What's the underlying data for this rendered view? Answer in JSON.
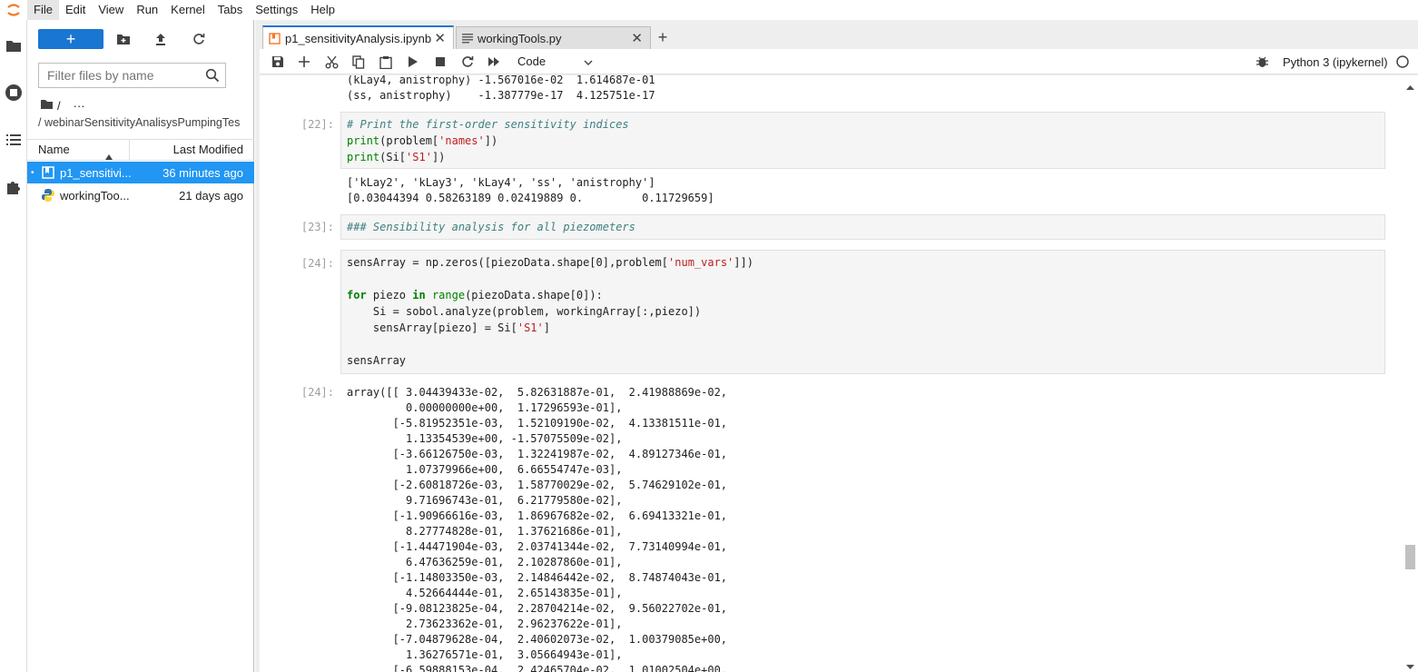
{
  "menu": [
    "File",
    "Edit",
    "View",
    "Run",
    "Kernel",
    "Tabs",
    "Settings",
    "Help"
  ],
  "filebrowser": {
    "new_label": "+",
    "filter_placeholder": "Filter files by name",
    "breadcrumb_root": "/",
    "breadcrumb_more": "···",
    "path": "/ webinarSensitivityAnalisysPumpingTes",
    "col_name": "Name",
    "col_modified": "Last Modified",
    "files": [
      {
        "name": "p1_sensitivi...",
        "modified": "36 minutes ago",
        "selected": true,
        "bullet": "•"
      },
      {
        "name": "workingToo...",
        "modified": "21 days ago",
        "selected": false
      }
    ]
  },
  "tabs": [
    {
      "label": "p1_sensitivityAnalysis.ipynb",
      "active": true,
      "close": "✕"
    },
    {
      "label": "workingTools.py",
      "active": false,
      "close": "✕"
    }
  ],
  "add_tab": "+",
  "toolbar": {
    "cell_type": "Code",
    "kernel": "Python 3 (ipykernel)"
  },
  "prev_output": [
    "(kLay4, anistrophy) -1.567016e-02  1.614687e-01",
    "(ss, anistrophy)    -1.387779e-17  4.125751e-17"
  ],
  "cells": [
    {
      "prompt": "[22]:",
      "code": [
        "# Print the first-order sensitivity indices",
        "print(problem['names'])",
        "print(Si['S1'])"
      ],
      "output": [
        "['kLay2', 'kLay3', 'kLay4', 'ss', 'anistrophy']",
        "[0.03044394 0.58263189 0.02419889 0.         0.11729659]"
      ]
    },
    {
      "prompt": "[23]:",
      "code": [
        "### Sensibility analysis for all piezometers"
      ]
    },
    {
      "prompt": "[24]:",
      "code": [
        "sensArray = np.zeros([piezoData.shape[0],problem['num_vars']])",
        "",
        "for piezo in range(piezoData.shape[0]):",
        "    Si = sobol.analyze(problem, workingArray[:,piezo])",
        "    sensArray[piezo] = Si['S1']",
        "",
        "sensArray"
      ],
      "out_prompt": "[24]:",
      "output": [
        "array([[ 3.04439433e-02,  5.82631887e-01,  2.41988869e-02,",
        "         0.00000000e+00,  1.17296593e-01],",
        "       [-5.81952351e-03,  1.52109190e-02,  4.13381511e-01,",
        "         1.13354539e+00, -1.57075509e-02],",
        "       [-3.66126750e-03,  1.32241987e-02,  4.89127346e-01,",
        "         1.07379966e+00,  6.66554747e-03],",
        "       [-2.60818726e-03,  1.58770029e-02,  5.74629102e-01,",
        "         9.71696743e-01,  6.21779580e-02],",
        "       [-1.90966616e-03,  1.86967682e-02,  6.69413321e-01,",
        "         8.27774828e-01,  1.37621686e-01],",
        "       [-1.44471904e-03,  2.03741344e-02,  7.73140994e-01,",
        "         6.47636259e-01,  2.10287860e-01],",
        "       [-1.14803350e-03,  2.14846442e-02,  8.74874043e-01,",
        "         4.52664444e-01,  2.65143835e-01],",
        "       [-9.08123825e-04,  2.28704214e-02,  9.56022702e-01,",
        "         2.73623362e-01,  2.96237622e-01],",
        "       [-7.04879628e-04,  2.40602073e-02,  1.00379085e+00,",
        "         1.36276571e-01,  3.05664943e-01],",
        "       [-6.59888153e-04,  2.42465704e-02,  1.01002504e+00,"
      ]
    }
  ],
  "colors": {
    "accent": "#1976d2",
    "selected_row": "#2196f3",
    "keyword": "#008000",
    "string": "#ba2121",
    "comment": "#408080"
  }
}
